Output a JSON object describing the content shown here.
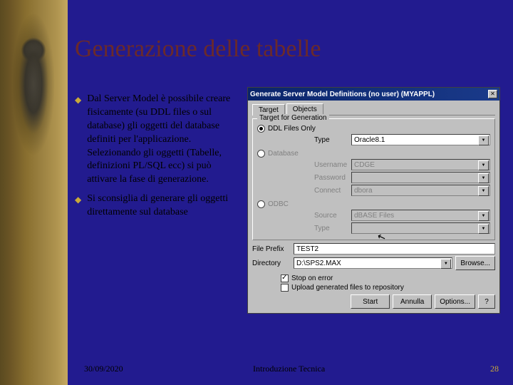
{
  "slide": {
    "title": "Generazione delle tabelle",
    "bullet1": "Dal Server Model è possibile creare fisicamente (su DDL files o sul database) gli oggetti del database definiti per l'applicazione. Selezionando gli oggetti (Tabelle, definizioni PL/SQL ecc) si può attivare la fase di generazione.",
    "bullet2": "Si sconsiglia di generare gli oggetti direttamente sul database",
    "footer_date": "30/09/2020",
    "footer_center": "Introduzione Tecnica",
    "footer_page": "28"
  },
  "dialog": {
    "title": "Generate Server Model Definitions (no user)  (MYAPPL)",
    "tabs": {
      "target": "Target",
      "objects": "Objects"
    },
    "fieldset_legend": "Target for Generation",
    "radio_ddl": "DDL Files Only",
    "radio_db": "Database",
    "radio_odbc": "ODBC",
    "type_lbl": "Type",
    "type_val": "Oracle8.1",
    "username_lbl": "Username",
    "username_val": "CDGE",
    "password_lbl": "Password",
    "connect_lbl": "Connect",
    "connect_val": "dbora",
    "source_lbl": "Source",
    "source_val": "dBASE Files",
    "type2_lbl": "Type",
    "filepfx_lbl": "File Prefix",
    "filepfx_val": "TEST2",
    "dir_lbl": "Directory",
    "dir_val": "D:\\SPS2.MAX",
    "browse": "Browse...",
    "chk_stop": "Stop on error",
    "chk_upload": "Upload generated files to repository",
    "btn_start": "Start",
    "btn_cancel": "Annulla",
    "btn_options": "Options...",
    "btn_help": "?"
  }
}
